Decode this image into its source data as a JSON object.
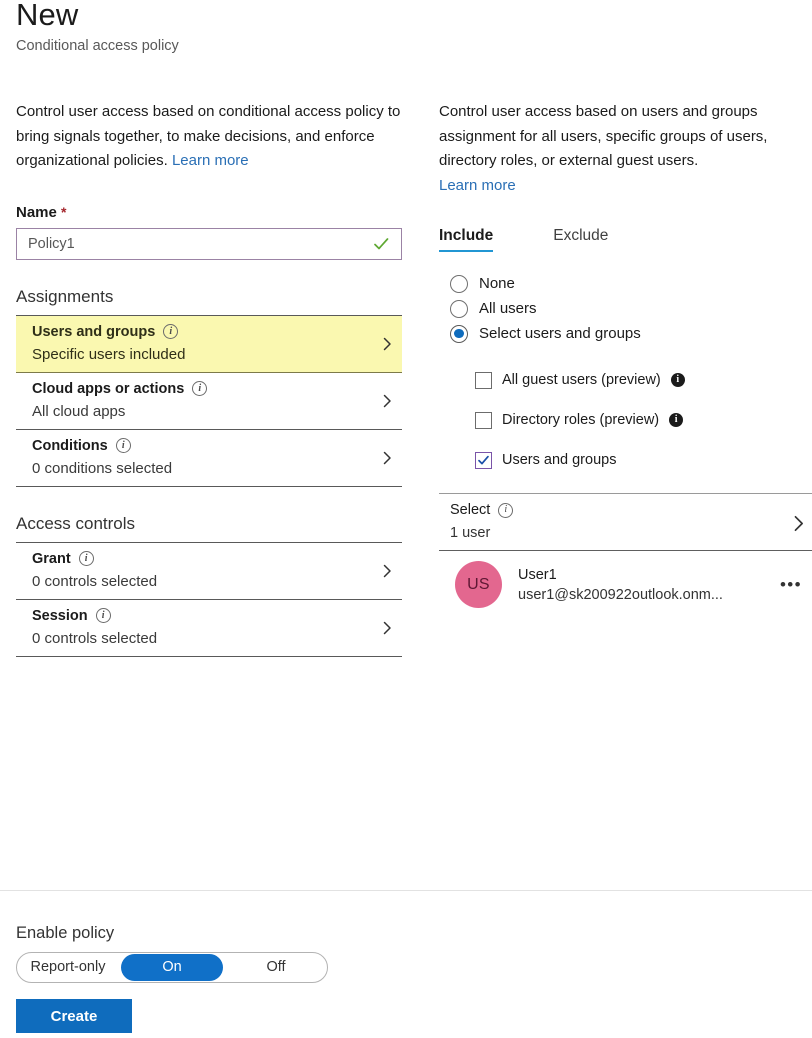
{
  "header": {
    "title": "New",
    "subtitle": "Conditional access policy"
  },
  "left": {
    "intro": "Control user access based on conditional access policy to bring signals together, to make decisions, and enforce organizational policies.",
    "intro_link": "Learn more",
    "name_label": "Name",
    "name_required_mark": "*",
    "name_value": "Policy1",
    "valid_icon": "green-check-icon",
    "assignments_heading": "Assignments",
    "assignment_rows": [
      {
        "title": "Users and groups",
        "value": "Specific users included",
        "info_icon": "info-circle-icon",
        "chevron": "chevron-right-icon",
        "highlighted": true
      },
      {
        "title": "Cloud apps or actions",
        "value": "All cloud apps",
        "info_icon": "info-circle-icon",
        "chevron": "chevron-right-icon",
        "highlighted": false
      },
      {
        "title": "Conditions",
        "value": "0 conditions selected",
        "info_icon": "info-circle-icon",
        "chevron": "chevron-right-icon",
        "highlighted": false
      }
    ],
    "access_controls_heading": "Access controls",
    "control_rows": [
      {
        "title": "Grant",
        "value": "0 controls selected",
        "info_icon": "info-circle-icon",
        "chevron": "chevron-right-icon"
      },
      {
        "title": "Session",
        "value": "0 controls selected",
        "info_icon": "info-circle-icon",
        "chevron": "chevron-right-icon"
      }
    ]
  },
  "right": {
    "intro": "Control user access based on users and groups assignment for all users, specific groups of users, directory roles, or external guest users.",
    "intro_link": "Learn more",
    "tabs": [
      {
        "label": "Include",
        "active": true
      },
      {
        "label": "Exclude",
        "active": false
      }
    ],
    "radios": [
      {
        "label": "None",
        "selected": false
      },
      {
        "label": "All users",
        "selected": false
      },
      {
        "label": "Select users and groups",
        "selected": true
      }
    ],
    "checkboxes": [
      {
        "label": "All guest users (preview)",
        "checked": false,
        "info_icon": "info-filled-icon"
      },
      {
        "label": "Directory roles (preview)",
        "checked": false,
        "info_icon": "info-filled-icon"
      },
      {
        "label": "Users and groups",
        "checked": true,
        "info_icon": null
      }
    ],
    "select_row": {
      "title": "Select",
      "value": "1 user",
      "info_icon": "info-circle-icon",
      "chevron": "chevron-right-icon"
    },
    "user": {
      "initials": "US",
      "name": "User1",
      "email": "user1@sk200922outlook.onm...",
      "avatar_color": "#E3678F",
      "more_icon": "ellipsis-icon",
      "more_label": "•••"
    }
  },
  "footer": {
    "enable_label": "Enable policy",
    "toggle_options": [
      {
        "label": "Report-only",
        "selected": false
      },
      {
        "label": "On",
        "selected": true
      },
      {
        "label": "Off",
        "selected": false
      }
    ],
    "create_label": "Create"
  },
  "colors": {
    "accent_blue": "#0F6CBD",
    "tab_underline": "#2196D3",
    "highlight_yellow": "#FAF8B0",
    "link_blue": "#2A6FB5",
    "required_red": "#A4262C",
    "input_border_purple": "#9B83A5",
    "check_green": "#5EA832",
    "checkbox_purple": "#7A54A8",
    "avatar_pink": "#E3678F"
  }
}
